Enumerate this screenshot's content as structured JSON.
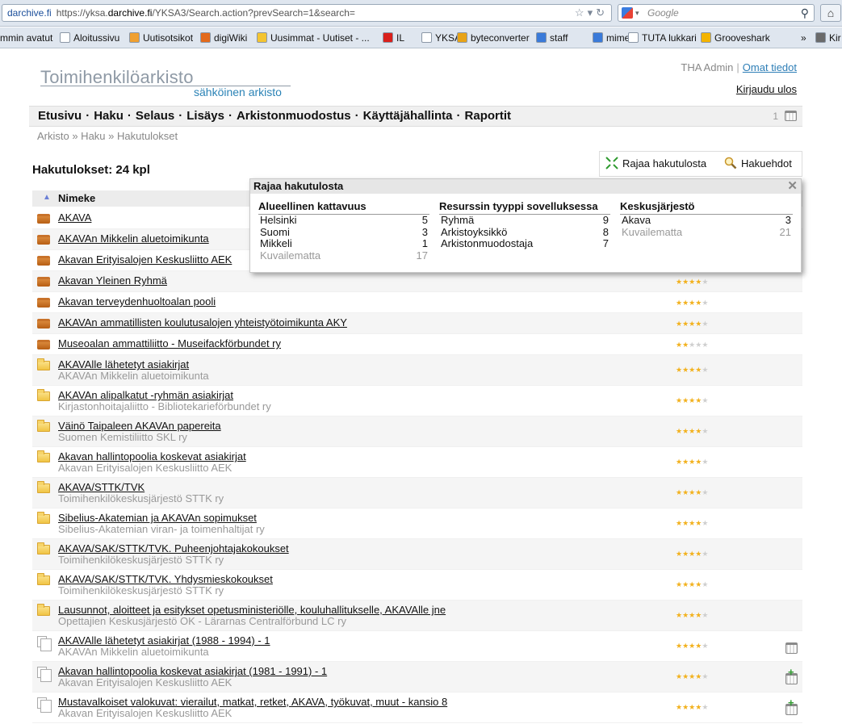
{
  "browser": {
    "site": "darchive.fi",
    "url_prefix": "https://yksa.",
    "url_host": "darchive.fi",
    "url_rest": "/YKSA3/Search.action?prevSearch=1&search=",
    "search_placeholder": "Google",
    "bookmarks": [
      {
        "label": "mmin avatut",
        "color": "#dfe6ef"
      },
      {
        "label": "Aloitussivu",
        "color": "#ffffff"
      },
      {
        "label": "Uutisotsikot",
        "color": "#f0a030"
      },
      {
        "label": "digiWiki",
        "color": "#e36a1c"
      },
      {
        "label": "Uusimmat - Uutiset - ...",
        "color": "#f4c430"
      },
      {
        "label": "IL",
        "color": "#d9201c"
      },
      {
        "label": "YKSA",
        "color": "#ffffff"
      },
      {
        "label": "byteconverter",
        "color": "#e8a317"
      },
      {
        "label": "staff",
        "color": "#3a7ad9"
      },
      {
        "label": "mime",
        "color": "#3a7ad9"
      },
      {
        "label": "TUTA lukkari",
        "color": "#ffffff"
      },
      {
        "label": "Grooveshark",
        "color": "#f4b400"
      },
      {
        "label": "»",
        "color": ""
      },
      {
        "label": "Kir",
        "color": "#6a6a6a"
      }
    ]
  },
  "header": {
    "logo_title": "Toimihenkilöarkisto",
    "logo_subtitle": "sähköinen arkisto",
    "user_name": "THA Admin",
    "own_info": "Omat tiedot",
    "logout": "Kirjaudu ulos"
  },
  "nav": {
    "items": [
      "Etusivu",
      "Haku",
      "Selaus",
      "Lisäys",
      "Arkistonmuodostus",
      "Käyttäjähallinta",
      "Raportit"
    ],
    "basket_count": "1"
  },
  "breadcrumb": "Arkisto » Haku » Hakutulokset",
  "results": {
    "title": "Hakutulokset: 24 kpl",
    "refine_label": "Rajaa hakutulosta",
    "criteria_label": "Hakuehdot",
    "column_name": "Nimeke",
    "rows": [
      {
        "type": "box",
        "title": "AKAVA",
        "sub": "",
        "stars": 0,
        "action": ""
      },
      {
        "type": "box",
        "title": "AKAVAn Mikkelin aluetoimikunta",
        "sub": "",
        "stars": 0,
        "action": ""
      },
      {
        "type": "box",
        "title": "Akavan Erityisalojen Keskusliitto AEK",
        "sub": "",
        "stars": 0,
        "action": ""
      },
      {
        "type": "box",
        "title": "Akavan Yleinen Ryhmä",
        "sub": "",
        "stars": 4,
        "action": ""
      },
      {
        "type": "box",
        "title": "Akavan terveydenhuoltoalan pooli",
        "sub": "",
        "stars": 4,
        "action": ""
      },
      {
        "type": "box",
        "title": "AKAVAn ammatillisten koulutusalojen yhteistyötoimikunta AKY",
        "sub": "",
        "stars": 4,
        "action": ""
      },
      {
        "type": "box",
        "title": "Museoalan ammattiliitto - Museifackförbundet ry",
        "sub": "",
        "stars": 2,
        "action": ""
      },
      {
        "type": "folder",
        "title": "AKAVAlle lähetetyt asiakirjat",
        "sub": "AKAVAn Mikkelin aluetoimikunta",
        "stars": 4,
        "action": ""
      },
      {
        "type": "folder",
        "title": "AKAVAn alipalkatut -ryhmän asiakirjat",
        "sub": "Kirjastonhoitajaliitto - Bibliotekarieförbundet ry",
        "stars": 4,
        "action": ""
      },
      {
        "type": "folder",
        "title": "Väinö Taipaleen AKAVAn papereita",
        "sub": "Suomen Kemistiliitto SKL ry",
        "stars": 4,
        "action": ""
      },
      {
        "type": "folder",
        "title": "Akavan hallintopoolia koskevat asiakirjat",
        "sub": "Akavan Erityisalojen Keskusliitto AEK",
        "stars": 4,
        "action": ""
      },
      {
        "type": "folder",
        "title": "AKAVA/STTK/TVK",
        "sub": "Toimihenkilökeskusjärjestö STTK ry",
        "stars": 4,
        "action": ""
      },
      {
        "type": "folder",
        "title": "Sibelius-Akatemian ja AKAVAn sopimukset",
        "sub": "Sibelius-Akatemian viran- ja toimenhaltijat ry",
        "stars": 4,
        "action": ""
      },
      {
        "type": "folder",
        "title": "AKAVA/SAK/STTK/TVK. Puheenjohtajakokoukset",
        "sub": "Toimihenkilökeskusjärjestö STTK ry",
        "stars": 4,
        "action": ""
      },
      {
        "type": "folder",
        "title": "AKAVA/SAK/STTK/TVK. Yhdysmieskokoukset",
        "sub": "Toimihenkilökeskusjärjestö STTK ry",
        "stars": 4,
        "action": ""
      },
      {
        "type": "folder",
        "title": "Lausunnot, aloitteet ja esitykset opetusministeriölle, kouluhallitukselle, AKAVAlle jne",
        "sub": "Opettajien Keskusjärjestö OK - Lärarnas Centralförbund LC ry",
        "stars": 4,
        "action": ""
      },
      {
        "type": "docs",
        "title": "AKAVAlle lähetetyt asiakirjat (1988 - 1994) - 1",
        "sub": "AKAVAn Mikkelin aluetoimikunta",
        "stars": 4,
        "action": "basket"
      },
      {
        "type": "docs",
        "title": "Akavan hallintopoolia koskevat asiakirjat (1981 - 1991) - 1",
        "sub": "Akavan Erityisalojen Keskusliitto AEK",
        "stars": 4,
        "action": "add-basket"
      },
      {
        "type": "docs",
        "title": "Mustavalkoiset valokuvat: vierailut, matkat, retket, AKAVA, työkuvat, muut - kansio 8",
        "sub": "Akavan Erityisalojen Keskusliitto AEK",
        "stars": 4,
        "action": "add-basket"
      }
    ]
  },
  "popup": {
    "title": "Rajaa hakutulosta",
    "columns": [
      {
        "heading": "Alueellinen kattavuus",
        "items": [
          {
            "name": "Helsinki",
            "count": "5",
            "muted": false
          },
          {
            "name": "Suomi",
            "count": "3",
            "muted": false
          },
          {
            "name": "Mikkeli",
            "count": "1",
            "muted": false
          },
          {
            "name": "Kuvailematta",
            "count": "17",
            "muted": true
          }
        ]
      },
      {
        "heading": "Resurssin tyyppi sovelluksessa",
        "items": [
          {
            "name": "Ryhmä",
            "count": "9",
            "muted": false
          },
          {
            "name": "Arkistoyksikkö",
            "count": "8",
            "muted": false
          },
          {
            "name": "Arkistonmuodostaja",
            "count": "7",
            "muted": false
          }
        ]
      },
      {
        "heading": "Keskusjärjestö",
        "items": [
          {
            "name": "Akava",
            "count": "3",
            "muted": false
          },
          {
            "name": "Kuvailematta",
            "count": "21",
            "muted": true
          }
        ]
      }
    ]
  }
}
